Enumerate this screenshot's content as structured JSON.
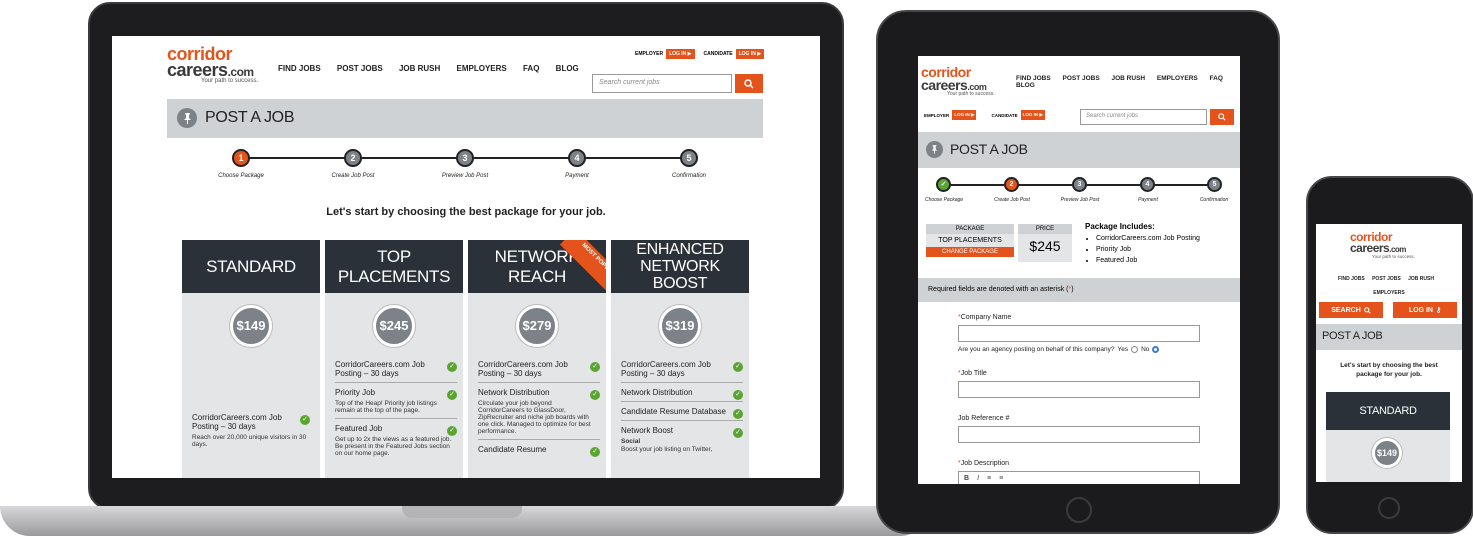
{
  "brand": {
    "logo_line1": "corridor",
    "logo_line2": "careers",
    "logo_suffix": ".com",
    "tagline": "Your path to success.",
    "accent": "#e4531c",
    "dark": "#2a3139",
    "check_color": "#5aa531"
  },
  "nav": {
    "items": [
      "FIND JOBS",
      "POST JOBS",
      "JOB RUSH",
      "EMPLOYERS",
      "FAQ",
      "BLOG"
    ]
  },
  "auth": {
    "employer_label": "EMPLOYER",
    "candidate_label": "CANDIDATE",
    "login_label": "LOG IN ▶"
  },
  "search": {
    "placeholder": "Search current jobs",
    "icon": "search-icon"
  },
  "page": {
    "title": "POST A JOB",
    "pin_icon": "pin-icon",
    "intro": "Let's start by choosing the best package for your job."
  },
  "steps": [
    {
      "num": "1",
      "label": "Choose Package"
    },
    {
      "num": "2",
      "label": "Create Job Post"
    },
    {
      "num": "3",
      "label": "Preview Job Post"
    },
    {
      "num": "4",
      "label": "Payment"
    },
    {
      "num": "5",
      "label": "Confirmation"
    }
  ],
  "packages": [
    {
      "name": "STANDARD",
      "price": "$149",
      "features": [
        {
          "title": "CorridorCareers.com Job Posting – 30 days",
          "desc": "Reach over 20,000 unique visitors in 30 days."
        }
      ]
    },
    {
      "name": "TOP PLACEMENTS",
      "price": "$245",
      "features": [
        {
          "title": "CorridorCareers.com Job Posting – 30 days",
          "desc": ""
        },
        {
          "title": "Priority Job",
          "desc": "Top of the Heap! Priority job listings remain at the top of the page."
        },
        {
          "title": "Featured Job",
          "desc": "Get up to 2x the views as a featured job. Be present in the Featured Jobs section on our home page."
        }
      ]
    },
    {
      "name": "NETWORK REACH",
      "price": "$279",
      "ribbon": "MOST POPULAR",
      "features": [
        {
          "title": "CorridorCareers.com Job Posting – 30 days",
          "desc": ""
        },
        {
          "title": "Network Distribution",
          "desc": "Circulate your job beyond CorridorCareers to GlassDoor, ZipRecruiter and niche job boards with one click. Managed to optimize for best performance."
        },
        {
          "title": "Candidate Resume",
          "desc": ""
        }
      ]
    },
    {
      "name": "ENHANCED NETWORK BOOST",
      "name_line1": "ENHANCED",
      "name_line2": "NETWORK BOOST",
      "price": "$319",
      "features": [
        {
          "title": "CorridorCareers.com Job Posting – 30 days",
          "desc": ""
        },
        {
          "title": "Network Distribution",
          "desc": ""
        },
        {
          "title": "Candidate Resume Database",
          "desc": ""
        },
        {
          "title": "Network Boost",
          "desc": "Boost your job listing on Twitter,",
          "sub": "Social"
        }
      ]
    }
  ],
  "tablet": {
    "summary": {
      "package_label": "PACKAGE",
      "package_value": "TOP PLACEMENTS",
      "change_label": "CHANGE PACKAGE",
      "price_label": "PRICE",
      "price_value": "$245",
      "includes_title": "Package Includes:",
      "includes": [
        "CorridorCareers.com Job Posting",
        "Priority Job",
        "Featured Job"
      ]
    },
    "required_note": "Required fields are denoted with an asterisk (",
    "required_star": "*",
    "required_close": ")",
    "fields": {
      "company_name": "Company Name",
      "agency_question": "Are you an agency posting on behalf of this company?",
      "yes": "Yes",
      "no": "No",
      "job_title": "Job Title",
      "job_reference": "Job Reference #",
      "job_description": "Job Description"
    },
    "editor_tools": [
      "B",
      "I",
      "≡",
      "≡"
    ]
  },
  "phone": {
    "search_label": "SEARCH",
    "login_label": "LOG IN",
    "title": "POST A JOB",
    "intro": "Let's start by choosing the best package for your job.",
    "package_name": "STANDARD",
    "package_price": "$149"
  }
}
